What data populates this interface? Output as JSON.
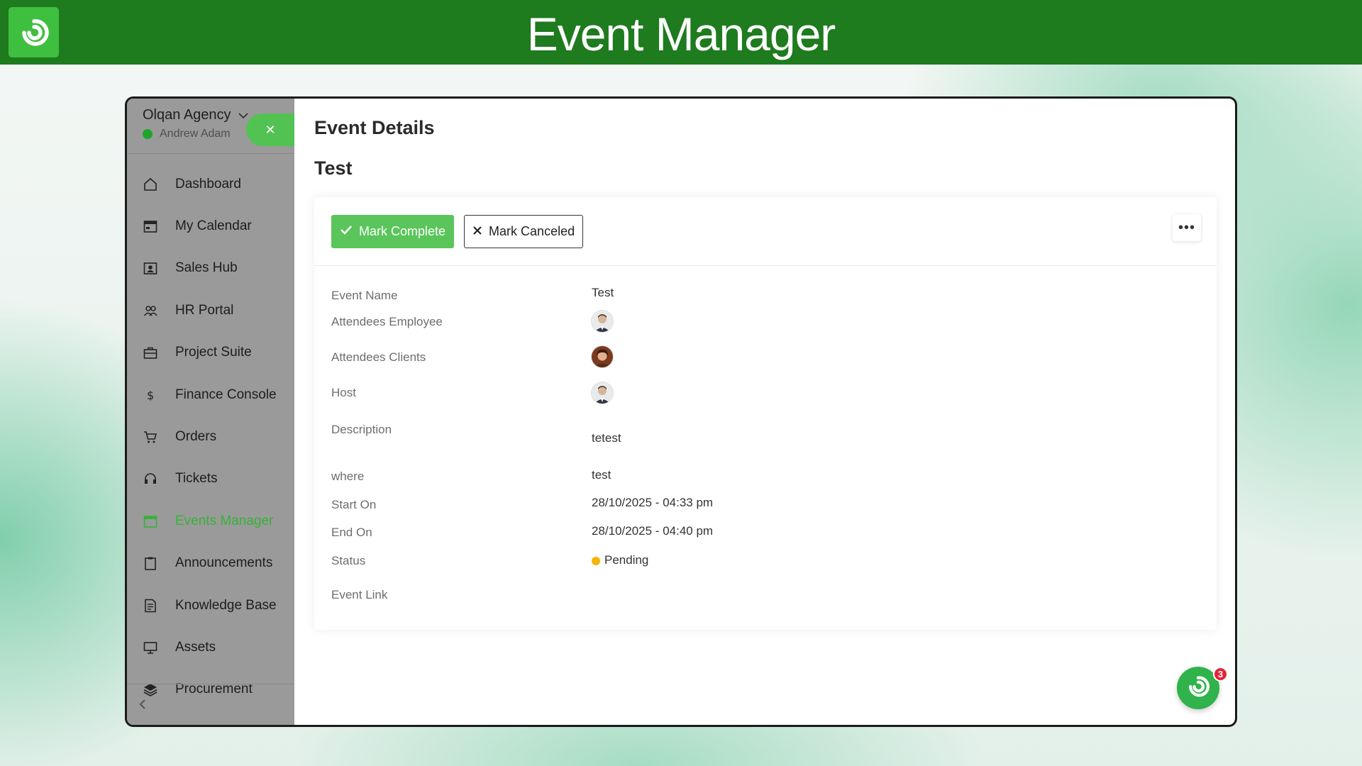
{
  "banner": {
    "title": "Event Manager",
    "logo_icon": "swirl-logo-icon"
  },
  "org": {
    "name": "Olqan Agency",
    "user": "Andrew Adam",
    "status_color": "#1fa52a"
  },
  "sidebar": {
    "items": [
      {
        "label": "Dashboard",
        "icon": "home-icon"
      },
      {
        "label": "My Calendar",
        "icon": "calendar-icon"
      },
      {
        "label": "Sales Hub",
        "icon": "contact-card-icon"
      },
      {
        "label": "HR Portal",
        "icon": "users-icon"
      },
      {
        "label": "Project Suite",
        "icon": "briefcase-icon"
      },
      {
        "label": "Finance Console",
        "icon": "dollar-icon"
      },
      {
        "label": "Orders",
        "icon": "cart-icon"
      },
      {
        "label": "Tickets",
        "icon": "headset-icon"
      },
      {
        "label": "Events Manager",
        "icon": "calendar-icon",
        "active": true
      },
      {
        "label": "Announcements",
        "icon": "clipboard-icon"
      },
      {
        "label": "Knowledge Base",
        "icon": "document-icon"
      },
      {
        "label": "Assets",
        "icon": "monitor-icon"
      },
      {
        "label": "Procurement",
        "icon": "layers-icon"
      }
    ],
    "active_color": "#38b238"
  },
  "main": {
    "page_title": "Event Details",
    "event_title": "Test",
    "actions": {
      "complete_label": "Mark Complete",
      "cancel_label": "Mark Canceled",
      "more_label": "•••"
    },
    "details": {
      "event_name_label": "Event Name",
      "event_name_value": "Test",
      "attendees_employee_label": "Attendees Employee",
      "attendees_clients_label": "Attendees Clients",
      "host_label": "Host",
      "description_label": "Description",
      "description_value": "tetest",
      "where_label": "where",
      "where_value": "test",
      "start_label": "Start On",
      "start_value": "28/10/2025 - 04:33 pm",
      "end_label": "End On",
      "end_value": "28/10/2025 - 04:40 pm",
      "status_label": "Status",
      "status_value": "Pending",
      "status_color": "#f5b400",
      "link_label": "Event Link"
    }
  },
  "fab": {
    "badge_count": "3",
    "color": "#2fb34a"
  }
}
